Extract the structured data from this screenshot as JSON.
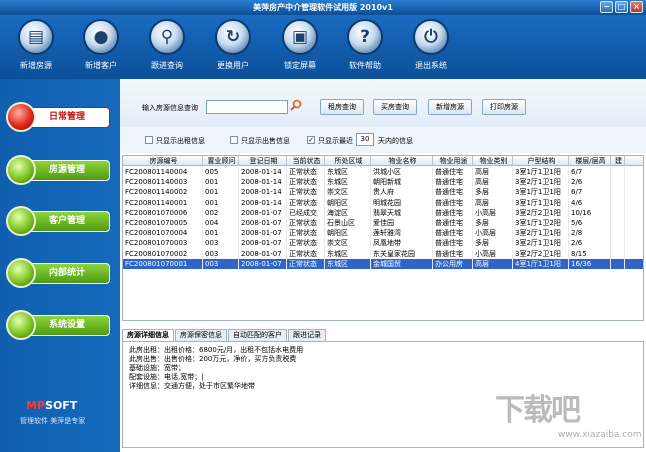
{
  "window": {
    "title": "美萍房产中介管理软件试用版 2010v1",
    "min": "−",
    "max": "□",
    "close": "×"
  },
  "toolbar": [
    {
      "label": "新增房源",
      "icon": "document-icon",
      "glyph": "▤"
    },
    {
      "label": "新增客户",
      "icon": "user-icon",
      "glyph": "●"
    },
    {
      "label": "跟进查询",
      "icon": "search-icon",
      "glyph": "⚲"
    },
    {
      "label": "更换用户",
      "icon": "switch-user-icon",
      "glyph": "↻"
    },
    {
      "label": "锁定屏幕",
      "icon": "lock-screen-icon",
      "glyph": "▣"
    },
    {
      "label": "软件帮助",
      "icon": "help-icon",
      "glyph": "?"
    },
    {
      "label": "退出系统",
      "icon": "power-icon",
      "glyph": "⏻"
    }
  ],
  "sidebar": [
    "日常管理",
    "房源管理",
    "客户管理",
    "内部统计",
    "系统设置"
  ],
  "logo": {
    "brand_a": "MP",
    "brand_b": "SOFT",
    "slogan": "管理软件 美萍是专家"
  },
  "search": {
    "label": "输入房源信息查询",
    "value": "",
    "buttons": [
      "租房查询",
      "买房查询",
      "新增房源",
      "打印房源"
    ]
  },
  "filters": {
    "rent_only": "只显示出租信息",
    "sale_only": "只显示出售信息",
    "recent_prefix": "只显示最近",
    "recent_days": "30",
    "recent_suffix": "天内的信息",
    "rent_checked": "",
    "sale_checked": "",
    "recent_checked": "✓"
  },
  "table": {
    "columns": [
      "房源编号",
      "置业顾问",
      "登记日期",
      "当前状态",
      "所处区域",
      "物业名称",
      "物业用途",
      "物业类别",
      "户型结构",
      "楼层/层高",
      "建"
    ],
    "rows": [
      [
        "FC200801140004",
        "005",
        "2008-01-14",
        "正常状态",
        "东城区",
        "洪城小区",
        "普通住宅",
        "高层",
        "3室1厅1卫1阳",
        "6/7",
        ""
      ],
      [
        "FC200801140003",
        "001",
        "2008-01-14",
        "正常状态",
        "东城区",
        "朝阳新城",
        "普通住宅",
        "高层",
        "3室2厅1卫1阳",
        "2/6",
        ""
      ],
      [
        "FC200801140002",
        "001",
        "2008-01-14",
        "正常状态",
        "崇文区",
        "贵人府",
        "普通住宅",
        "多层",
        "3室1厅1卫1阳",
        "6/7",
        ""
      ],
      [
        "FC200801140001",
        "001",
        "2008-01-14",
        "正常状态",
        "朝阳区",
        "明城花园",
        "普通住宅",
        "高层",
        "3室1厅1卫1阳",
        "4/6",
        ""
      ],
      [
        "FC200801070006",
        "002",
        "2008-01-07",
        "已经成交",
        "海淀区",
        "翡翠天城",
        "普通住宅",
        "小高层",
        "3室2厅2卫1阳",
        "10/16",
        ""
      ],
      [
        "FC200801070005",
        "004",
        "2008-01-07",
        "正常状态",
        "石景山区",
        "爱佳园",
        "普通住宅",
        "多层",
        "3室1厅1卫2阳",
        "5/6",
        ""
      ],
      [
        "FC200801070004",
        "001",
        "2008-01-07",
        "正常状态",
        "朝阳区",
        "莲轩雅湾",
        "普通住宅",
        "小高层",
        "3室2厅1卫1阳",
        "2/8",
        ""
      ],
      [
        "FC200801070003",
        "003",
        "2008-01-07",
        "正常状态",
        "崇文区",
        "凤凰地带",
        "普通住宅",
        "多层",
        "3室2厅1卫1阳",
        "2/6",
        ""
      ],
      [
        "FC200801070002",
        "003",
        "2008-01-07",
        "正常状态",
        "东城区",
        "东关皇家花园",
        "普通住宅",
        "小高层",
        "3室2厅2卫1阳",
        "8/15",
        ""
      ],
      [
        "FC200801070001",
        "003",
        "2008-01-07",
        "正常状态",
        "东城区",
        "金城国贸",
        "办公用房",
        "高层",
        "4室1厅1卫1阳",
        "16/36",
        ""
      ]
    ],
    "selected_index": 9
  },
  "tabs": [
    "房源详细信息",
    "房源保密信息",
    "自动匹配的客户",
    "跟进记录"
  ],
  "detail": [
    "此房出租：出租价格：6800元/月，出租不包括水电费用",
    "此房出售：出售价格：200万元，净价，买方负责税费",
    "",
    "基础设施：宽带；",
    "配套设施：电话,宽带；|",
    "",
    "详细信息：交通方便，处于市区繁华地带"
  ],
  "watermark": {
    "big": "下载吧",
    "small": "www.xiazaiba.com"
  }
}
